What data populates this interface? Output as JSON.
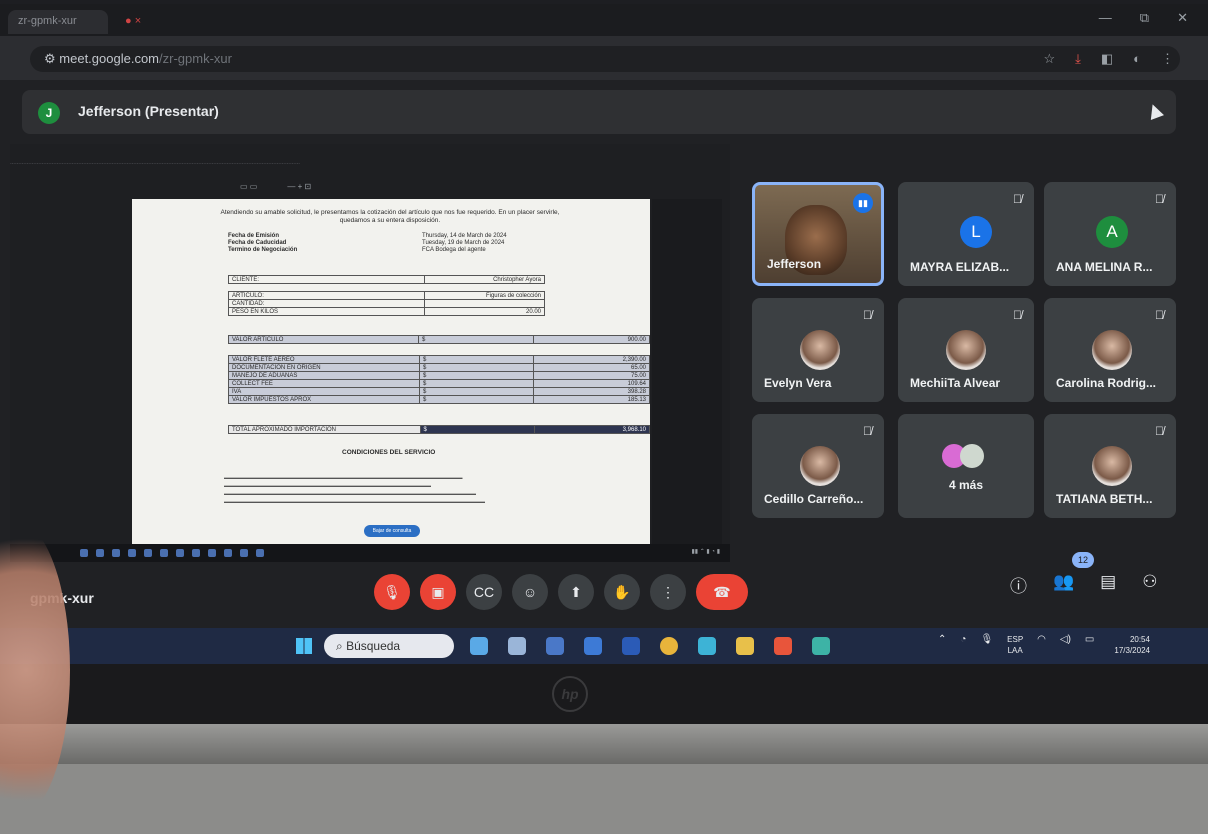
{
  "browser": {
    "tab_title": "zr-gpmk-xur",
    "url_host": "meet.google.com",
    "url_path": "/zr-gpmk-xur"
  },
  "presenter": {
    "initial": "J",
    "label": "Jefferson (Presentar)"
  },
  "shared_doc": {
    "intro": "Atendiendo su amable solicitud, le presentamos la cotización del artículo que nos fue requerido. En un placer servirle, quedamos a su entera disposición.",
    "fields": [
      {
        "label": "Fecha de Emisión",
        "value": "Thursday, 14 de March de 2024"
      },
      {
        "label": "Fecha de Caducidad",
        "value": "Tuesday, 19 de March de 2024"
      },
      {
        "label": "Termino de Negociación",
        "value": "FCA Bodega del agente"
      }
    ],
    "client_label": "CLIENTE:",
    "client_value": "Christopher Ayora",
    "article_rows": [
      {
        "label": "ARTICULO:",
        "value": "Figuras de colección"
      },
      {
        "label": "CANTIDAD:",
        "value": ""
      },
      {
        "label": "PESO EN KILOS",
        "value": "20.00"
      }
    ],
    "valor_articulo": {
      "label": "VALOR ARTICULO",
      "currency": "$",
      "value": "900.00"
    },
    "cost_rows": [
      {
        "label": "VALOR FLETE AEREO",
        "currency": "$",
        "value": "2,390.00"
      },
      {
        "label": "DOCUMENTACION EN ORIGEN",
        "currency": "$",
        "value": "65.00"
      },
      {
        "label": "MANEJO DE ADUANAS",
        "currency": "$",
        "value": "75.00"
      },
      {
        "label": "COLLECT FEE",
        "currency": "$",
        "value": "109.64"
      },
      {
        "label": "IVA",
        "currency": "$",
        "value": "398.28"
      },
      {
        "label": "VALOR IMPUESTOS APROX",
        "currency": "$",
        "value": "185.13"
      }
    ],
    "total": {
      "label": "TOTAL APROXIMADO IMPORTACION",
      "currency": "$",
      "value": "3,968.10"
    },
    "conditions_title": "CONDICIONES DEL SERVICIO",
    "conditions_button": "Bajar de consulta"
  },
  "participants": [
    {
      "name": "Jefferson"
    },
    {
      "name": "MAYRA ELIZAB...",
      "initial": "L",
      "color": "#1a73e8"
    },
    {
      "name": "ANA MELINA R...",
      "initial": "A",
      "color": "#1e8e3e"
    },
    {
      "name": "Evelyn Vera"
    },
    {
      "name": "MechiiTa Alvear"
    },
    {
      "name": "Carolina Rodrig..."
    },
    {
      "name": "Cedillo Carreño..."
    },
    {
      "name": "4 más"
    },
    {
      "name": "TATIANA BETH..."
    }
  ],
  "meeting": {
    "code": "gpmk-xur",
    "people_count": "12"
  },
  "taskbar": {
    "search_label": "Búsqueda",
    "lang_1": "ESP",
    "lang_2": "LAA",
    "time": "20:54",
    "date": "17/3/2024"
  },
  "colors": {
    "meet_bg": "#202124",
    "tile_bg": "#3c4043",
    "hangup": "#ea4335",
    "active_speaker": "#8ab4f8"
  },
  "icons": [
    "mic-off-icon",
    "camera-off-icon",
    "captions-icon",
    "emoji-icon",
    "present-icon",
    "raise-hand-icon",
    "more-options-icon",
    "hangup-icon",
    "info-icon",
    "people-icon",
    "chat-icon",
    "activities-icon"
  ]
}
